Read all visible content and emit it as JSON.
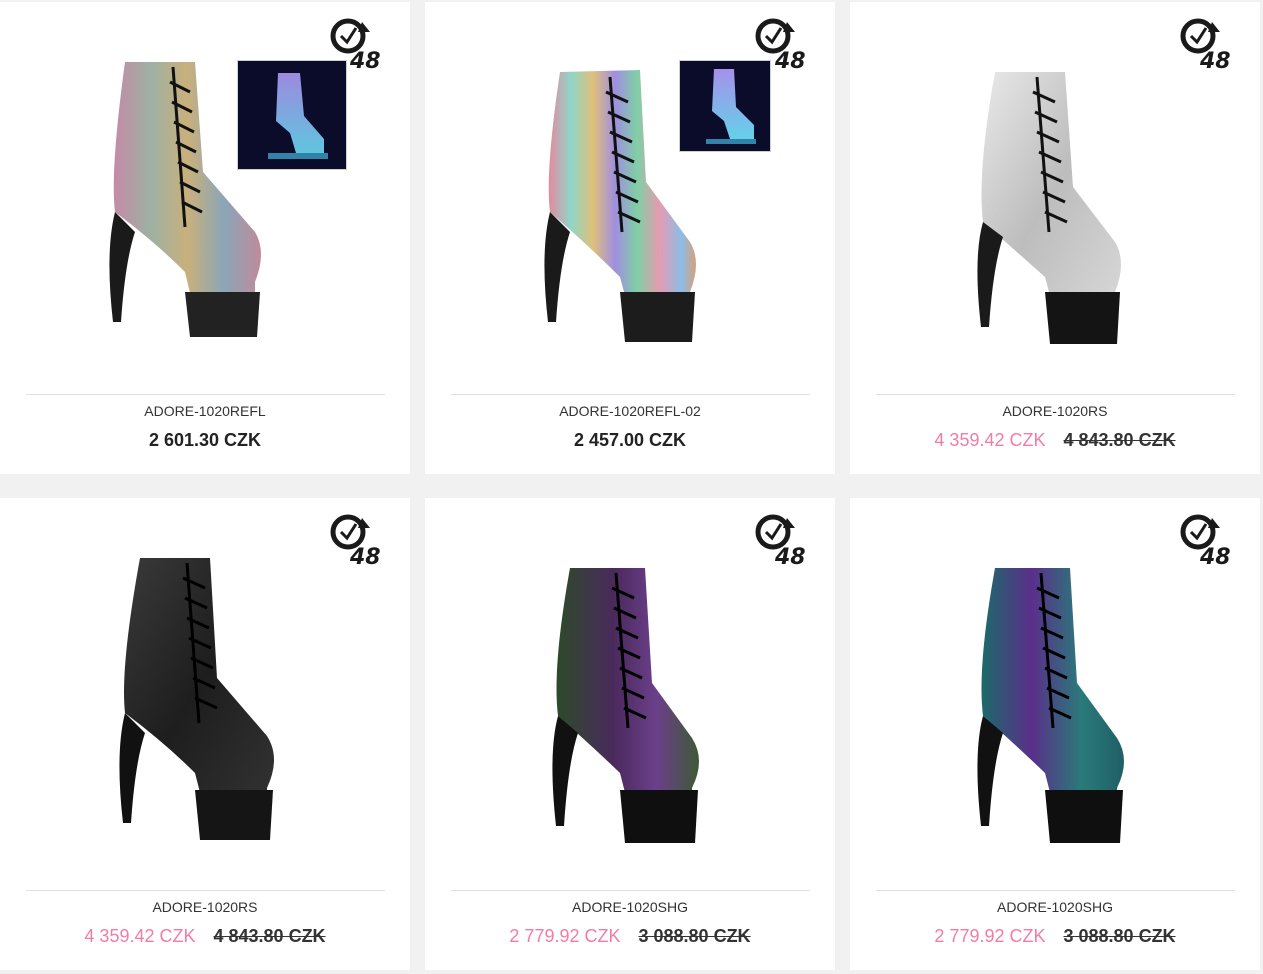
{
  "badge": {
    "text": "48",
    "icon": "clock-48h-icon"
  },
  "products": [
    {
      "name": "ADORE-1020REFL",
      "price": "2 601.30 CZK",
      "sale_price": "",
      "old_price": "",
      "variant": "rainbow-reflective",
      "has_thumbnail": true
    },
    {
      "name": "ADORE-1020REFL-02",
      "price": "2 457.00 CZK",
      "sale_price": "",
      "old_price": "",
      "variant": "rainbow-reflective-stripes",
      "has_thumbnail": true
    },
    {
      "name": "ADORE-1020RS",
      "price": "",
      "sale_price": "4 359.42 CZK",
      "old_price": "4 843.80 CZK",
      "variant": "silver-rhinestone",
      "has_thumbnail": false
    },
    {
      "name": "ADORE-1020RS",
      "price": "",
      "sale_price": "4 359.42 CZK",
      "old_price": "4 843.80 CZK",
      "variant": "black-rhinestone",
      "has_thumbnail": false
    },
    {
      "name": "ADORE-1020SHG",
      "price": "",
      "sale_price": "2 779.92 CZK",
      "old_price": "3 088.80 CZK",
      "variant": "purple-green-hologram",
      "has_thumbnail": false
    },
    {
      "name": "ADORE-1020SHG",
      "price": "",
      "sale_price": "2 779.92 CZK",
      "old_price": "3 088.80 CZK",
      "variant": "teal-purple-hologram",
      "has_thumbnail": false
    }
  ],
  "colors": {
    "sale": "#f27ca5",
    "text": "#222222",
    "background": "#f1f1f1",
    "card": "#ffffff"
  }
}
